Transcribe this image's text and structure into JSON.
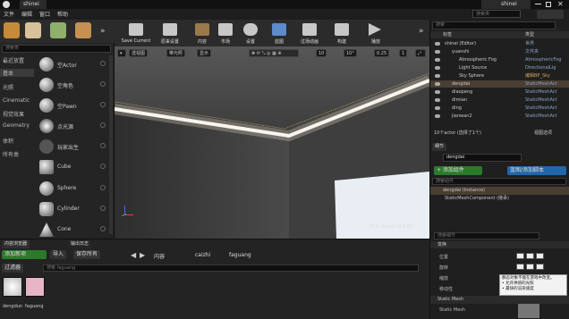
{
  "window": {
    "title": "shinei",
    "project": "shinei"
  },
  "menu": [
    "文件",
    "编辑",
    "窗口",
    "帮助"
  ],
  "modes": {
    "search_placeholder": "搜索类"
  },
  "categories": [
    {
      "label": "最近放置"
    },
    {
      "label": "基本"
    },
    {
      "label": "光照"
    },
    {
      "label": "Cinematic"
    },
    {
      "label": "视觉效果"
    },
    {
      "label": "Geometry"
    },
    {
      "label": "体积"
    },
    {
      "label": "所有类"
    }
  ],
  "actors": [
    {
      "label": "空Actor"
    },
    {
      "label": "空角色"
    },
    {
      "label": "空Pawn"
    },
    {
      "label": "点光源"
    },
    {
      "label": "玩家出生"
    },
    {
      "label": "Cube"
    },
    {
      "label": "Sphere"
    },
    {
      "label": "Cylinder"
    },
    {
      "label": "Cone"
    }
  ],
  "toolbar": [
    {
      "label": "Save Current"
    },
    {
      "label": "原来设置"
    },
    {
      "label": "内容"
    },
    {
      "label": "市场"
    },
    {
      "label": "设置"
    },
    {
      "label": "蓝图"
    },
    {
      "label": "过场动画"
    },
    {
      "label": "构建"
    },
    {
      "label": "播放"
    }
  ],
  "viewport": {
    "perspective": "透视图",
    "lit": "带光照",
    "show": "显示",
    "grid": "10",
    "rot": "10°",
    "scale": "0.25",
    "cam": "1",
    "level_label": "关卡: shinei (永久性)"
  },
  "outliner": {
    "search_placeholder": "搜索",
    "header_label": "标签",
    "header_type": "类型",
    "rows": [
      {
        "name": "shinei (Editor)",
        "type": "世界",
        "indent": 0,
        "selected": false,
        "orange": false
      },
      {
        "name": "yuanshi",
        "type": "文件夹",
        "indent": 1,
        "selected": false,
        "orange": false
      },
      {
        "name": "Atmospheric Fog",
        "type": "AtmosphericFog",
        "indent": 2,
        "selected": false,
        "orange": false
      },
      {
        "name": "Light Source",
        "type": "DirectionalLig",
        "indent": 2,
        "selected": false,
        "orange": false
      },
      {
        "name": "Sky Sphere",
        "type": "编辑BP_Sky",
        "indent": 2,
        "selected": false,
        "orange": true
      },
      {
        "name": "dengdai",
        "type": "StaticMeshAct",
        "indent": 1,
        "selected": true,
        "orange": false
      },
      {
        "name": "diaopeng",
        "type": "StaticMeshAct",
        "indent": 1,
        "selected": false,
        "orange": false
      },
      {
        "name": "dimian",
        "type": "StaticMeshAct",
        "indent": 1,
        "selected": false,
        "orange": false
      },
      {
        "name": "ding",
        "type": "StaticMeshAct",
        "indent": 1,
        "selected": false,
        "orange": false
      },
      {
        "name": "jianwan2",
        "type": "StaticMeshAct",
        "indent": 1,
        "selected": false,
        "orange": false
      }
    ],
    "status": "10个actor (选择了1个)",
    "view_options": "视图选项"
  },
  "details": {
    "tab": "细节",
    "name_value": "dengdai",
    "add_component": "+ 添加组件",
    "blueprint": "蓝图/添加脚本",
    "search_placeholder": "搜索组件",
    "instance": "dengdai (Instance)",
    "component": "StaticMeshComponent (继承)",
    "search_details": "搜索细节",
    "transform_header": "变换",
    "location": "位置",
    "rotation": "旋转",
    "scale": "缩放",
    "mobility": "移动性",
    "static_mesh_header": "Static Mesh",
    "static_mesh_label": "Static Mesh"
  },
  "tooltip": {
    "line1": "静态对象不能在游戏中改变。",
    "line2": "• 允许烘焙的光照",
    "line3": "• 最快的渲染速度"
  },
  "content": {
    "tab1": "内容浏览器",
    "tab2": "输出日志",
    "add_new": "添加新项",
    "import": "导入",
    "save_all": "保存所有",
    "filters": "过滤器",
    "search_placeholder": "搜索 faguang",
    "crumbs": [
      "内容",
      "caizhi",
      "faguang"
    ],
    "assets": [
      {
        "label": "dengdun"
      },
      {
        "label": "faguang"
      }
    ]
  },
  "colors": {
    "accent_green": "#2b7a2b",
    "accent_blue": "#2266aa",
    "selection": "#4a3e33"
  }
}
